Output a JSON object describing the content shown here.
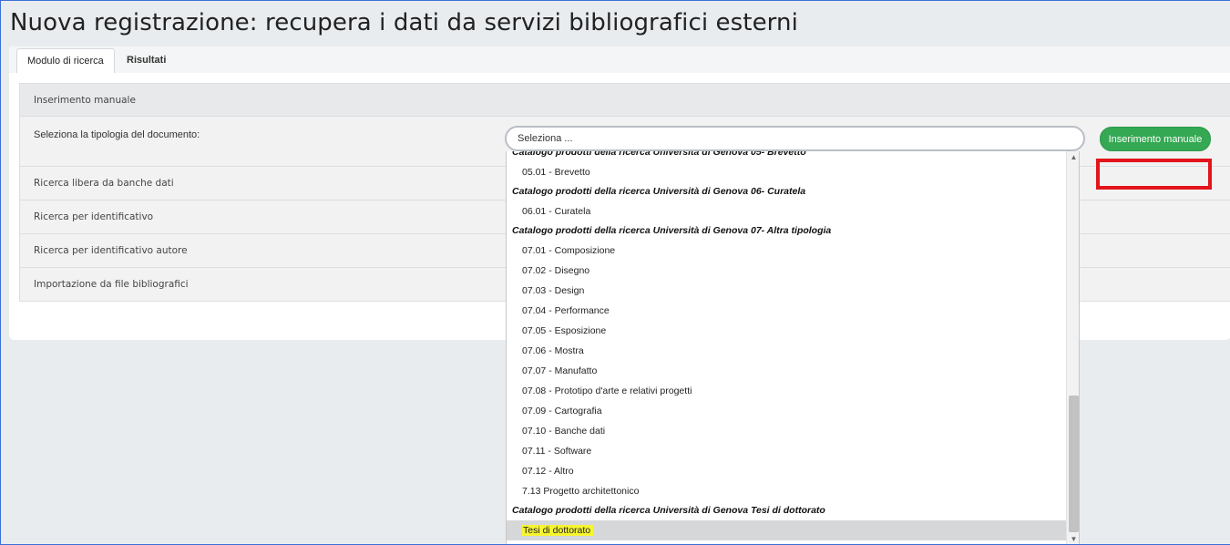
{
  "page_title": "Nuova registrazione: recupera i dati da servizi bibliografici esterni",
  "tabs": [
    {
      "label": "Modulo di ricerca"
    },
    {
      "label": "Risultati"
    }
  ],
  "panel": {
    "rows": [
      {
        "label": "Inserimento manuale"
      },
      {
        "label": "Seleziona la tipologia del documento:"
      },
      {
        "label": "Ricerca libera da banche dati"
      },
      {
        "label": "Ricerca per identificativo"
      },
      {
        "label": "Ricerca per identificativo autore"
      },
      {
        "label": "Importazione da file bibliografici"
      }
    ]
  },
  "select": {
    "placeholder": "Seleziona ..."
  },
  "button_manual": "Inserimento manuale",
  "dropdown": {
    "partial_group": "Catalogo prodotti della ricerca Università di Genova 05- Brevetto",
    "items": [
      {
        "type": "opt",
        "label": "05.01 - Brevetto"
      },
      {
        "type": "group",
        "label": "Catalogo prodotti della ricerca Università di Genova 06- Curatela"
      },
      {
        "type": "opt",
        "label": "06.01 - Curatela"
      },
      {
        "type": "group",
        "label": "Catalogo prodotti della ricerca Università di Genova 07- Altra tipologia"
      },
      {
        "type": "opt",
        "label": "07.01 - Composizione"
      },
      {
        "type": "opt",
        "label": "07.02 - Disegno"
      },
      {
        "type": "opt",
        "label": "07.03 - Design"
      },
      {
        "type": "opt",
        "label": "07.04 - Performance"
      },
      {
        "type": "opt",
        "label": "07.05 - Esposizione"
      },
      {
        "type": "opt",
        "label": "07.06 - Mostra"
      },
      {
        "type": "opt",
        "label": "07.07 - Manufatto"
      },
      {
        "type": "opt",
        "label": "07.08 - Prototipo d'arte e relativi progetti"
      },
      {
        "type": "opt",
        "label": "07.09 - Cartografia"
      },
      {
        "type": "opt",
        "label": "07.10 - Banche dati"
      },
      {
        "type": "opt",
        "label": "07.11 - Software"
      },
      {
        "type": "opt",
        "label": "07.12 - Altro"
      },
      {
        "type": "opt",
        "label": "7.13 Progetto architettonico"
      },
      {
        "type": "group",
        "label": "Catalogo prodotti della ricerca Università di Genova Tesi di dottorato"
      },
      {
        "type": "opt",
        "label": "Tesi di dottorato",
        "selected": true
      }
    ]
  },
  "colors": {
    "button_green": "#34a853",
    "highlight_yellow": "#f7f531",
    "annotation_red": "#e3141b"
  }
}
